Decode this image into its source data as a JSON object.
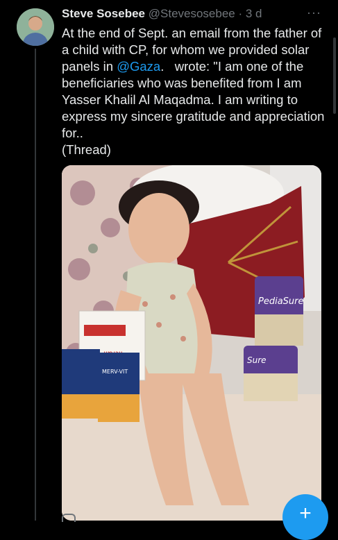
{
  "tweet": {
    "author_name": "Steve Sosebee",
    "handle": "@Stevesosebee",
    "separator": " · ",
    "time": "3 d",
    "text_before_mention": "At the end of Sept. an email from the father of a child with CP, for whom we provided solar panels in ",
    "mention": "@Gaza",
    "text_after_mention": ".   wrote: \"I am one of the beneficiaries who was benefited from I am Yasser Khalil Al Maqadma. I am writing to express my sincere gratitude and appreciation for..\n(Thread)"
  },
  "media": {
    "can_label_left": "PediaSure",
    "can_label_right": "Sure",
    "box_label": "ויטמין",
    "small_box_label": "MERV-VIT"
  },
  "icons": {
    "more": "more-horizontal-icon",
    "compose": "compose-plus-icon"
  },
  "colors": {
    "accent": "#1d9bf0",
    "background": "#000000",
    "muted": "#71767b"
  }
}
